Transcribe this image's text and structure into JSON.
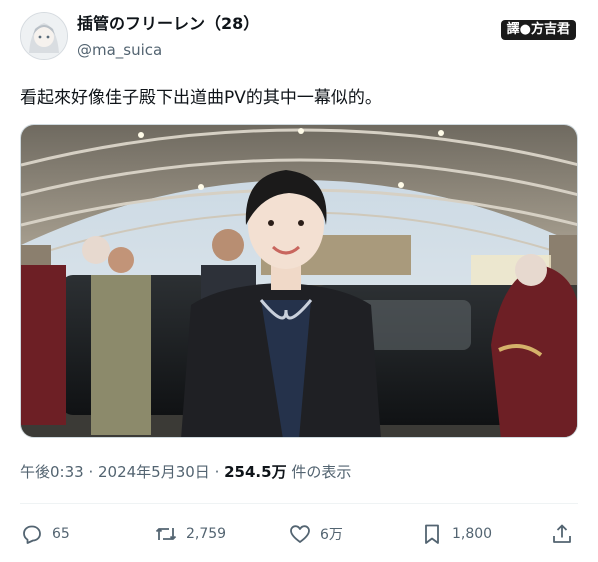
{
  "author": {
    "display_name": "插管のフリーレン（28）",
    "handle": "@ma_suica"
  },
  "watermark": "譯●方吉君",
  "tweet": {
    "text": "看起來好像佳子殿下出道曲PV的其中一幕似的。"
  },
  "meta": {
    "time": "午後0:33",
    "separator1": " · ",
    "date": "2024年5月30日",
    "separator2": " · ",
    "views": "254.5万",
    "views_suffix": " 件の表示"
  },
  "actions": {
    "replies": "65",
    "retweets": "2,759",
    "likes": "6万",
    "bookmarks": "1,800"
  }
}
